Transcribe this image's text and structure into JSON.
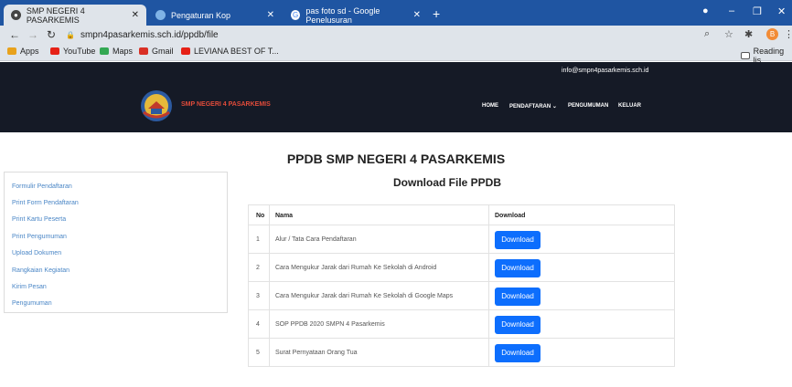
{
  "browser": {
    "tabs": [
      {
        "title": "SMP NEGERI 4 PASARKEMIS",
        "active": true
      },
      {
        "title": "Pengaturan Kop",
        "active": false
      },
      {
        "title": "pas foto sd - Google Penelusuran",
        "active": false
      }
    ],
    "new_tab": "+",
    "url": "smpn4pasarkemis.sch.id/ppdb/file",
    "profile_initial": "B",
    "bookmarks": [
      {
        "label": "Apps",
        "color": "#e8a21c"
      },
      {
        "label": "YouTube",
        "color": "#e62117"
      },
      {
        "label": "Maps",
        "color": "#34a853"
      },
      {
        "label": "Gmail",
        "color": "#d93025"
      },
      {
        "label": "LEVIANA BEST OF T...",
        "color": "#e62117"
      }
    ],
    "reading_list": "Reading lis"
  },
  "site": {
    "email": "info@smpn4pasarkemis.sch.id",
    "name": "SMP NEGERI 4 PASARKEMIS",
    "menu": [
      "HOME",
      "PENDAFTARAN ⌄",
      "PENGUMUMAN",
      "KELUAR"
    ],
    "page_title": "PPDB SMP NEGERI 4 PASARKEMIS",
    "sidebar": [
      "Formulir Pendaftaran",
      "Print Form Pendaftaran",
      "Print Kartu Peserta",
      "Print Pengumuman",
      "Upload Dokumen",
      "Rangkaian Kegiatan",
      "Kirim Pesan",
      "Pengumuman"
    ],
    "subtitle": "Download File PPDB",
    "table": {
      "headers": [
        "No",
        "Nama",
        "Download"
      ],
      "rows": [
        {
          "no": "1",
          "nama": "Alur / Tata Cara Pendaftaran",
          "button": "Download"
        },
        {
          "no": "2",
          "nama": "Cara Mengukur Jarak dari Rumah Ke Sekolah di Android",
          "button": "Download"
        },
        {
          "no": "3",
          "nama": "Cara Mengukur Jarak dari Rumah Ke Sekolah di Google Maps",
          "button": "Download"
        },
        {
          "no": "4",
          "nama": "SOP PPDB 2020 SMPN 4 Pasarkemis",
          "button": "Download"
        },
        {
          "no": "5",
          "nama": "Surat Pernyataan Orang Tua",
          "button": "Download"
        }
      ]
    }
  }
}
